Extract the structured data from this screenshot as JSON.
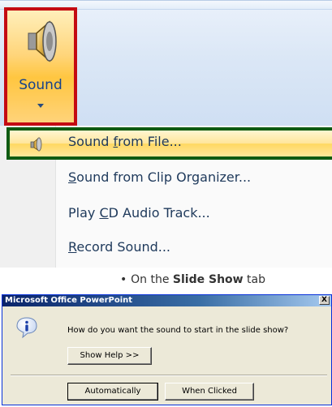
{
  "ribbon": {
    "sound_button": {
      "label": "Sound",
      "icon": "speaker-icon",
      "dropdown_icon": "chevron-down-icon"
    }
  },
  "menu": {
    "items": [
      {
        "pre": "Sound ",
        "key": "f",
        "post": "rom File...",
        "icon": "speaker-icon",
        "highlighted": true
      },
      {
        "pre": "",
        "key": "S",
        "post": "ound from Clip Organizer..."
      },
      {
        "pre": "Play ",
        "key": "C",
        "post": "D Audio Track..."
      },
      {
        "pre": "",
        "key": "R",
        "post": "ecord Sound..."
      }
    ]
  },
  "slide": {
    "bullet": "•",
    "text_lead": "On the ",
    "text_bold": "Slide Show",
    "text_tail": " tab"
  },
  "dialog": {
    "title": "Microsoft Office PowerPoint",
    "close_label": "X",
    "icon": "info-icon",
    "question": "How do you want the sound to start in the slide show?",
    "show_help_label": "Show Help >>",
    "automatically_label": "Automatically",
    "when_clicked_label": "When Clicked"
  },
  "colors": {
    "highlight_box_red": "#c40b12",
    "highlight_box_green": "#0f5b12",
    "menu_text": "#1e395b",
    "ribbon_label": "#15428b",
    "dialog_titlebar": "#0a246a"
  }
}
